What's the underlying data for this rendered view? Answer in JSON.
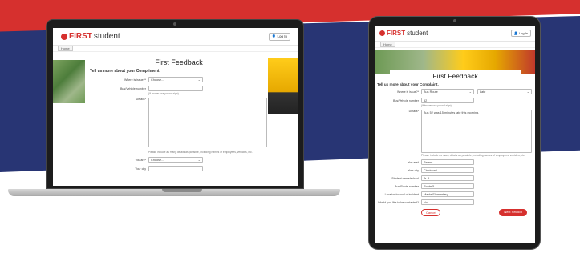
{
  "brand": {
    "first": "FIRST",
    "student": "student",
    "accent": "#d6302e",
    "navy": "#283574"
  },
  "header": {
    "login_label": "Log In"
  },
  "nav": {
    "home_label": "Home"
  },
  "form": {
    "title": "First Feedback",
    "laptop_subtitle": "Tell us more about your Compliment.",
    "tablet_subtitle": "Tell us more about your Complaint.",
    "where_label": "Where is issue?*",
    "where_value": "Choose...",
    "bus_label": "Bus/Vehicle number",
    "bus_hint": "(If known use pound sign)",
    "details_label": "Details*",
    "details_hint": "Please include as many details as possible, including names of employees, vehicles, etc.",
    "you_are_label": "You are*",
    "you_are_value": "Choose...",
    "your_city_label": "Your city"
  },
  "tablet": {
    "where_label": "Where is issue?*",
    "where_value": "Bus Route",
    "where_value2": "Late",
    "bus_label": "Bus/Vehicle number",
    "bus_value": "52",
    "details_label": "Details*",
    "details_value": "Bus 52 was 15 minutes late this morning.",
    "details_hint": "Please include as many details as possible, including names of employees, vehicles, etc.",
    "you_are_label": "You are*",
    "you_are_value": "Parent",
    "city_label": "Your city",
    "city_value": "Cincinnati",
    "school_label": "Student name/school",
    "school_value": "Jr. 5",
    "route_label": "Bus Route number",
    "route_value": "Route 5",
    "location_label": "Location/school of incident",
    "location_value": "Maple Elementary",
    "contacted_label": "Would you like to be contacted?",
    "contacted_value": "No",
    "cancel_label": "Cancel",
    "next_label": "Next Section"
  }
}
